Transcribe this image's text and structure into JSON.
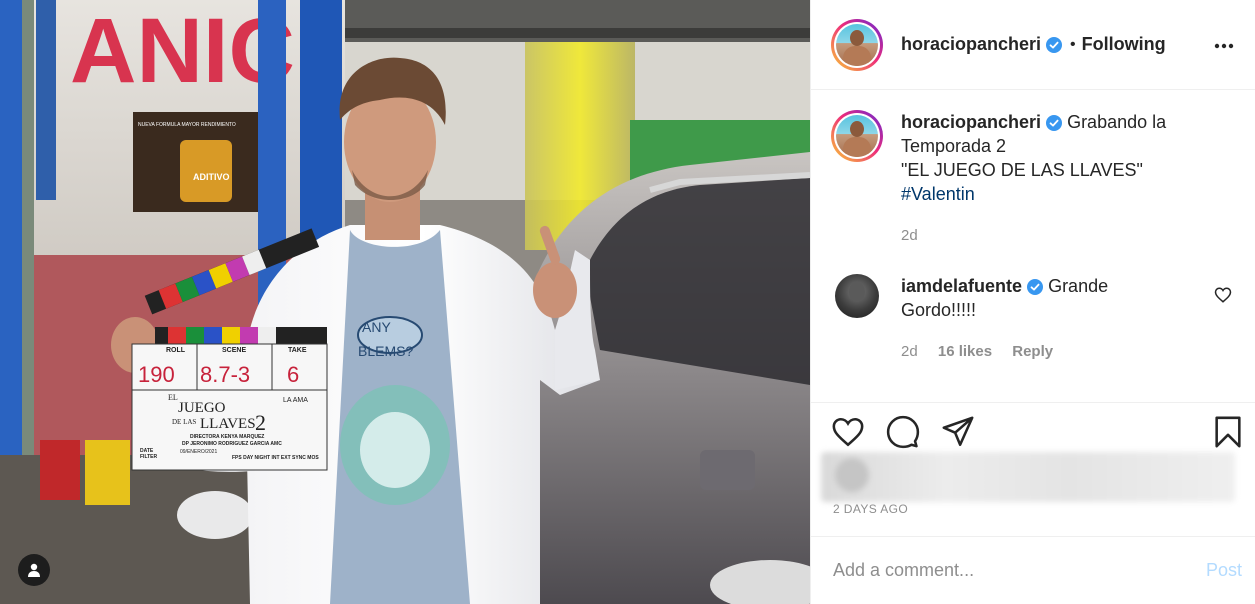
{
  "post": {
    "author": "horaciopancheri",
    "verified": true,
    "follow_state": "Following",
    "separator": "•",
    "caption_lines": [
      "Grabando la",
      "Temporada 2",
      "\"EL JUEGO DE LAS LLAVES\""
    ],
    "hashtag": "#Valentin",
    "caption_age": "2d",
    "timestamp": "2 DAYS AGO"
  },
  "comments": [
    {
      "author": "iamdelafuente",
      "verified": true,
      "text_line1": "Grande",
      "text_line2": "Gordo!!!!!",
      "age": "2d",
      "likes": "16 likes",
      "reply": "Reply"
    }
  ],
  "clapperboard": {
    "roll_label": "ROLL",
    "scene_label": "SCENE",
    "take_label": "TAKE",
    "roll": "190",
    "scene": "8.7-3",
    "take": "6",
    "title_top": "EL",
    "title_main": "JUEGO",
    "title_sub": "DE LAS",
    "title_llaves": "LLAVES",
    "title_num": "2",
    "la_ama": "LA AMA",
    "directora": "DIRECTORA KENYA MARQUEZ",
    "dp": "DP JERONIMO RODRIGUEZ GARCIA AMC",
    "date_label": "DATE",
    "filter_label": "FILTER",
    "date": "09/ENERO/2021",
    "fps": "FPS DAY NIGHT INT EXT SYNC MOS"
  },
  "scene_text": {
    "sign": "ANIC",
    "shirt": "ANY",
    "shirt2": "BLEMS?",
    "poster_brand": "ADITIVO",
    "poster_line": "NUEVA FORMULA MAYOR RENDIMIENTO"
  },
  "add_comment": {
    "placeholder": "Add a comment...",
    "post_label": "Post"
  },
  "colors": {
    "verified": "#3897f0",
    "link": "#00376b",
    "muted": "#8e8e8e",
    "post_disabled": "#b3dbff"
  },
  "icons": {
    "more": "more-horizontal-icon",
    "like": "heart-icon",
    "comment": "comment-icon",
    "share": "paper-plane-icon",
    "save": "bookmark-icon",
    "user_tag": "user-tag-icon"
  }
}
